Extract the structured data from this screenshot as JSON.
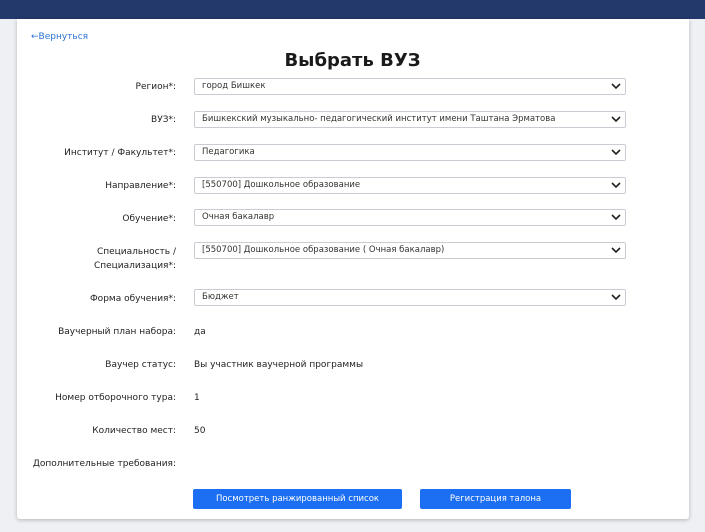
{
  "page": {
    "back_link": "←Вернуться",
    "title": "Выбрать ВУЗ"
  },
  "fields": {
    "region": {
      "label": "Регион*:",
      "value": "город Бишкек"
    },
    "vuz": {
      "label": "ВУЗ*:",
      "value": "Бишкекский музыкально- педагогический институт имени Таштана Эрматова"
    },
    "faculty": {
      "label": "Институт / Факультет*:",
      "value": "Педагогика"
    },
    "direction": {
      "label": "Направление*:",
      "value": "[550700] Дошкольное образование"
    },
    "study": {
      "label": "Обучение*:",
      "value": "Очная бакалавр"
    },
    "specialty": {
      "label_line1": "Специальность /",
      "label_line2": "Специализация*:",
      "value": "[550700] Дошкольное образование ( Очная бакалавр)"
    },
    "form": {
      "label": "Форма обучения*:",
      "value": "Бюджет"
    }
  },
  "info": {
    "voucher_plan": {
      "label": "Ваучерный план набора:",
      "value": "да"
    },
    "voucher_status": {
      "label": "Ваучер статус:",
      "value": "Вы участник ваучерной программы"
    },
    "tour_number": {
      "label": "Номер отборочного тура:",
      "value": "1"
    },
    "seats": {
      "label": "Количество мест:",
      "value": "50"
    },
    "extra_requirements": {
      "label": "Дополнительные требования:",
      "value": ""
    }
  },
  "buttons": {
    "ranked_list": "Посмотреть ранжированный список",
    "register_ticket": "Регистрация талона"
  },
  "colors": {
    "topbar": "#23386b",
    "accent": "#1c6ef2",
    "link": "#2a72d6"
  }
}
